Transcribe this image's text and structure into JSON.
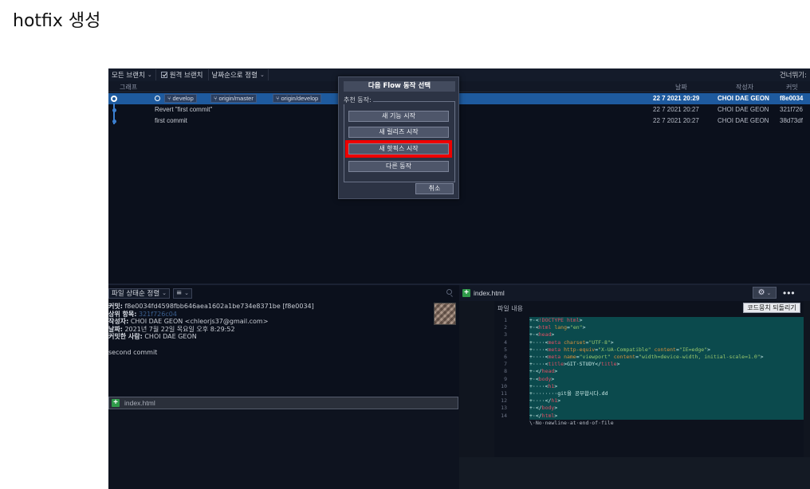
{
  "page_title": "hotfix 생성",
  "toolbar": {
    "branch_filter": "모든 브랜치",
    "remote_branch": "원격 브랜치",
    "sort_order": "날짜순으로 정렬",
    "jump_to": "건너뛰기:"
  },
  "columns": {
    "graph": "그래프",
    "date": "날짜",
    "author": "작성자",
    "commit": "커밋"
  },
  "commits": [
    {
      "branches": [
        "develop",
        "origin/master",
        "origin/develop"
      ],
      "message": "",
      "date": "22 7 2021 20:29",
      "author": "CHOI DAE GEON",
      "hash": "f8e0034"
    },
    {
      "branches": [],
      "message": "Revert \"first commit\"",
      "date": "22 7 2021 20:27",
      "author": "CHOI DAE GEON",
      "hash": "321f726"
    },
    {
      "branches": [],
      "message": "first commit",
      "date": "22 7 2021 20:27",
      "author": "CHOI DAE GEON",
      "hash": "38d73df"
    }
  ],
  "dialog": {
    "title": "다음 Flow 동작 선택",
    "group_label": "추천 동작:",
    "new_feature": "새 기능 시작",
    "new_release": "새 릴리즈 시작",
    "new_hotfix": "새 핫픽스 시작",
    "other_action": "다른 동작",
    "cancel": "취소",
    "highlight_color": "#ee0000"
  },
  "lower_left": {
    "file_sort": "파일 상태순 정렬",
    "view_icon": "list-icon",
    "commit_info": {
      "commit_label": "커밋:",
      "commit_value": "f8e0034fd4598fbb646aea1602a1be734e8371be [f8e0034]",
      "parent_label": "상위 항목:",
      "parent_value": "321f726c04",
      "author_label": "작성자:",
      "author_value": "CHOI DAE GEON <chleorjs37@gmail.com>",
      "date_label": "날짜:",
      "date_value": "2021년 7월 22일 목요일 오후 8:29:52",
      "committer_label": "커밋한 사람:",
      "committer_value": "CHOI DAE GEON"
    },
    "message": "second commit",
    "file": "index.html"
  },
  "lower_right": {
    "file": "index.html",
    "content_label": "파일 내용",
    "revert_button": "코드뭉치 되돌리기",
    "lines": [
      {
        "n": "1",
        "parts": [
          [
            "t",
            "+·<"
          ],
          [
            "tag",
            "!DOCTYPE html"
          ],
          [
            "t",
            ">"
          ]
        ]
      },
      {
        "n": "2",
        "parts": [
          [
            "t",
            "+·<"
          ],
          [
            "tag",
            "html"
          ],
          [
            "t",
            " "
          ],
          [
            "attr",
            "lang"
          ],
          [
            "t",
            "="
          ],
          [
            "str",
            "\"en\""
          ],
          [
            "t",
            ">"
          ]
        ]
      },
      {
        "n": "3",
        "parts": [
          [
            "t",
            "+·<"
          ],
          [
            "tag",
            "head"
          ],
          [
            "t",
            ">"
          ]
        ]
      },
      {
        "n": "4",
        "parts": [
          [
            "t",
            "+····<"
          ],
          [
            "tag",
            "meta"
          ],
          [
            "t",
            " "
          ],
          [
            "attr",
            "charset"
          ],
          [
            "t",
            "="
          ],
          [
            "str",
            "\"UTF-8\""
          ],
          [
            "t",
            ">"
          ]
        ]
      },
      {
        "n": "5",
        "parts": [
          [
            "t",
            "+····<"
          ],
          [
            "tag",
            "meta"
          ],
          [
            "t",
            " "
          ],
          [
            "attr",
            "http-equiv"
          ],
          [
            "t",
            "="
          ],
          [
            "str",
            "\"X-UA-Compatible\""
          ],
          [
            "t",
            " "
          ],
          [
            "attr",
            "content"
          ],
          [
            "t",
            "="
          ],
          [
            "str",
            "\"IE=edge\""
          ],
          [
            "t",
            ">"
          ]
        ]
      },
      {
        "n": "6",
        "parts": [
          [
            "t",
            "+····<"
          ],
          [
            "tag",
            "meta"
          ],
          [
            "t",
            " "
          ],
          [
            "attr",
            "name"
          ],
          [
            "t",
            "="
          ],
          [
            "str",
            "\"viewport\""
          ],
          [
            "t",
            " "
          ],
          [
            "attr",
            "content"
          ],
          [
            "t",
            "="
          ],
          [
            "str",
            "\"width=device-width, initial-scale=1.0\""
          ],
          [
            "t",
            ">"
          ]
        ]
      },
      {
        "n": "7",
        "parts": [
          [
            "t",
            "+····<"
          ],
          [
            "tag",
            "title"
          ],
          [
            "t",
            ">GIT·STUDY</"
          ],
          [
            "tag",
            "title"
          ],
          [
            "t",
            ">"
          ]
        ]
      },
      {
        "n": "8",
        "parts": [
          [
            "t",
            "+·</"
          ],
          [
            "tag",
            "head"
          ],
          [
            "t",
            ">"
          ]
        ]
      },
      {
        "n": "9",
        "parts": [
          [
            "t",
            "+·<"
          ],
          [
            "tag",
            "body"
          ],
          [
            "t",
            ">"
          ]
        ]
      },
      {
        "n": "10",
        "parts": [
          [
            "t",
            "+····<"
          ],
          [
            "tag",
            "h1"
          ],
          [
            "t",
            ">"
          ]
        ]
      },
      {
        "n": "11",
        "parts": [
          [
            "t",
            "+········git을 공부합시다.dd"
          ]
        ]
      },
      {
        "n": "12",
        "parts": [
          [
            "t",
            "+····</"
          ],
          [
            "tag",
            "h1"
          ],
          [
            "t",
            ">"
          ]
        ]
      },
      {
        "n": "13",
        "parts": [
          [
            "t",
            "+·</"
          ],
          [
            "tag",
            "body"
          ],
          [
            "t",
            ">"
          ]
        ]
      },
      {
        "n": "14",
        "parts": [
          [
            "t",
            "+·</"
          ],
          [
            "tag",
            "html"
          ],
          [
            "t",
            ">"
          ]
        ]
      }
    ],
    "no_newline": "\\·No·newline·at·end·of·file"
  }
}
